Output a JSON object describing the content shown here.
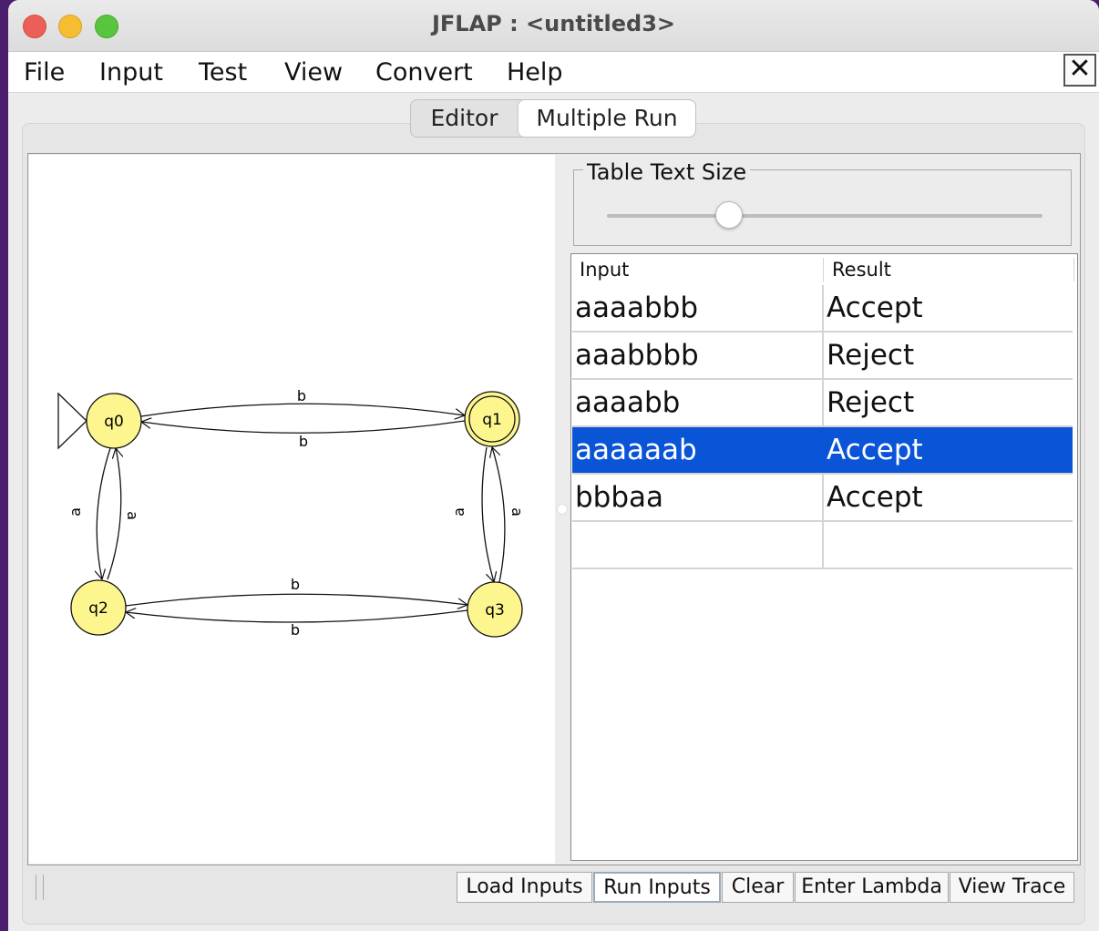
{
  "window": {
    "title": "JFLAP : <untitled3>"
  },
  "menu": {
    "items": [
      "File",
      "Input",
      "Test",
      "View",
      "Convert",
      "Help"
    ],
    "close_glyph": "✕"
  },
  "tabs": {
    "editor": "Editor",
    "multiple_run": "Multiple Run",
    "active": "Multiple Run"
  },
  "automaton": {
    "states": [
      "q0",
      "q1",
      "q2",
      "q3"
    ],
    "initial_state": "q0",
    "final_states": [
      "q1"
    ],
    "state_fill": "#fdf68f",
    "transitions": [
      {
        "from": "q0",
        "to": "q1",
        "label": "b"
      },
      {
        "from": "q1",
        "to": "q0",
        "label": "b"
      },
      {
        "from": "q0",
        "to": "q2",
        "label": "a"
      },
      {
        "from": "q2",
        "to": "q0",
        "label": "a"
      },
      {
        "from": "q1",
        "to": "q3",
        "label": "a"
      },
      {
        "from": "q3",
        "to": "q1",
        "label": "a"
      },
      {
        "from": "q2",
        "to": "q3",
        "label": "b"
      },
      {
        "from": "q3",
        "to": "q2",
        "label": "b"
      }
    ]
  },
  "table_text_size": {
    "label": "Table Text Size",
    "slider_fraction": 0.28
  },
  "table": {
    "headers": [
      "Input",
      "Result"
    ],
    "rows": [
      {
        "input": "aaaabbb",
        "result": "Accept"
      },
      {
        "input": "aaabbbb",
        "result": "Reject"
      },
      {
        "input": "aaaabb",
        "result": "Reject"
      },
      {
        "input": "aaaaaab",
        "result": "Accept"
      },
      {
        "input": "bbbaa",
        "result": "Accept"
      },
      {
        "input": "",
        "result": ""
      }
    ],
    "selected_row": 3,
    "selection_color": "#0a54d8"
  },
  "buttons": {
    "load_inputs": "Load Inputs",
    "run_inputs": "Run Inputs",
    "clear": "Clear",
    "enter_lambda": "Enter Lambda",
    "view_trace": "View Trace"
  }
}
